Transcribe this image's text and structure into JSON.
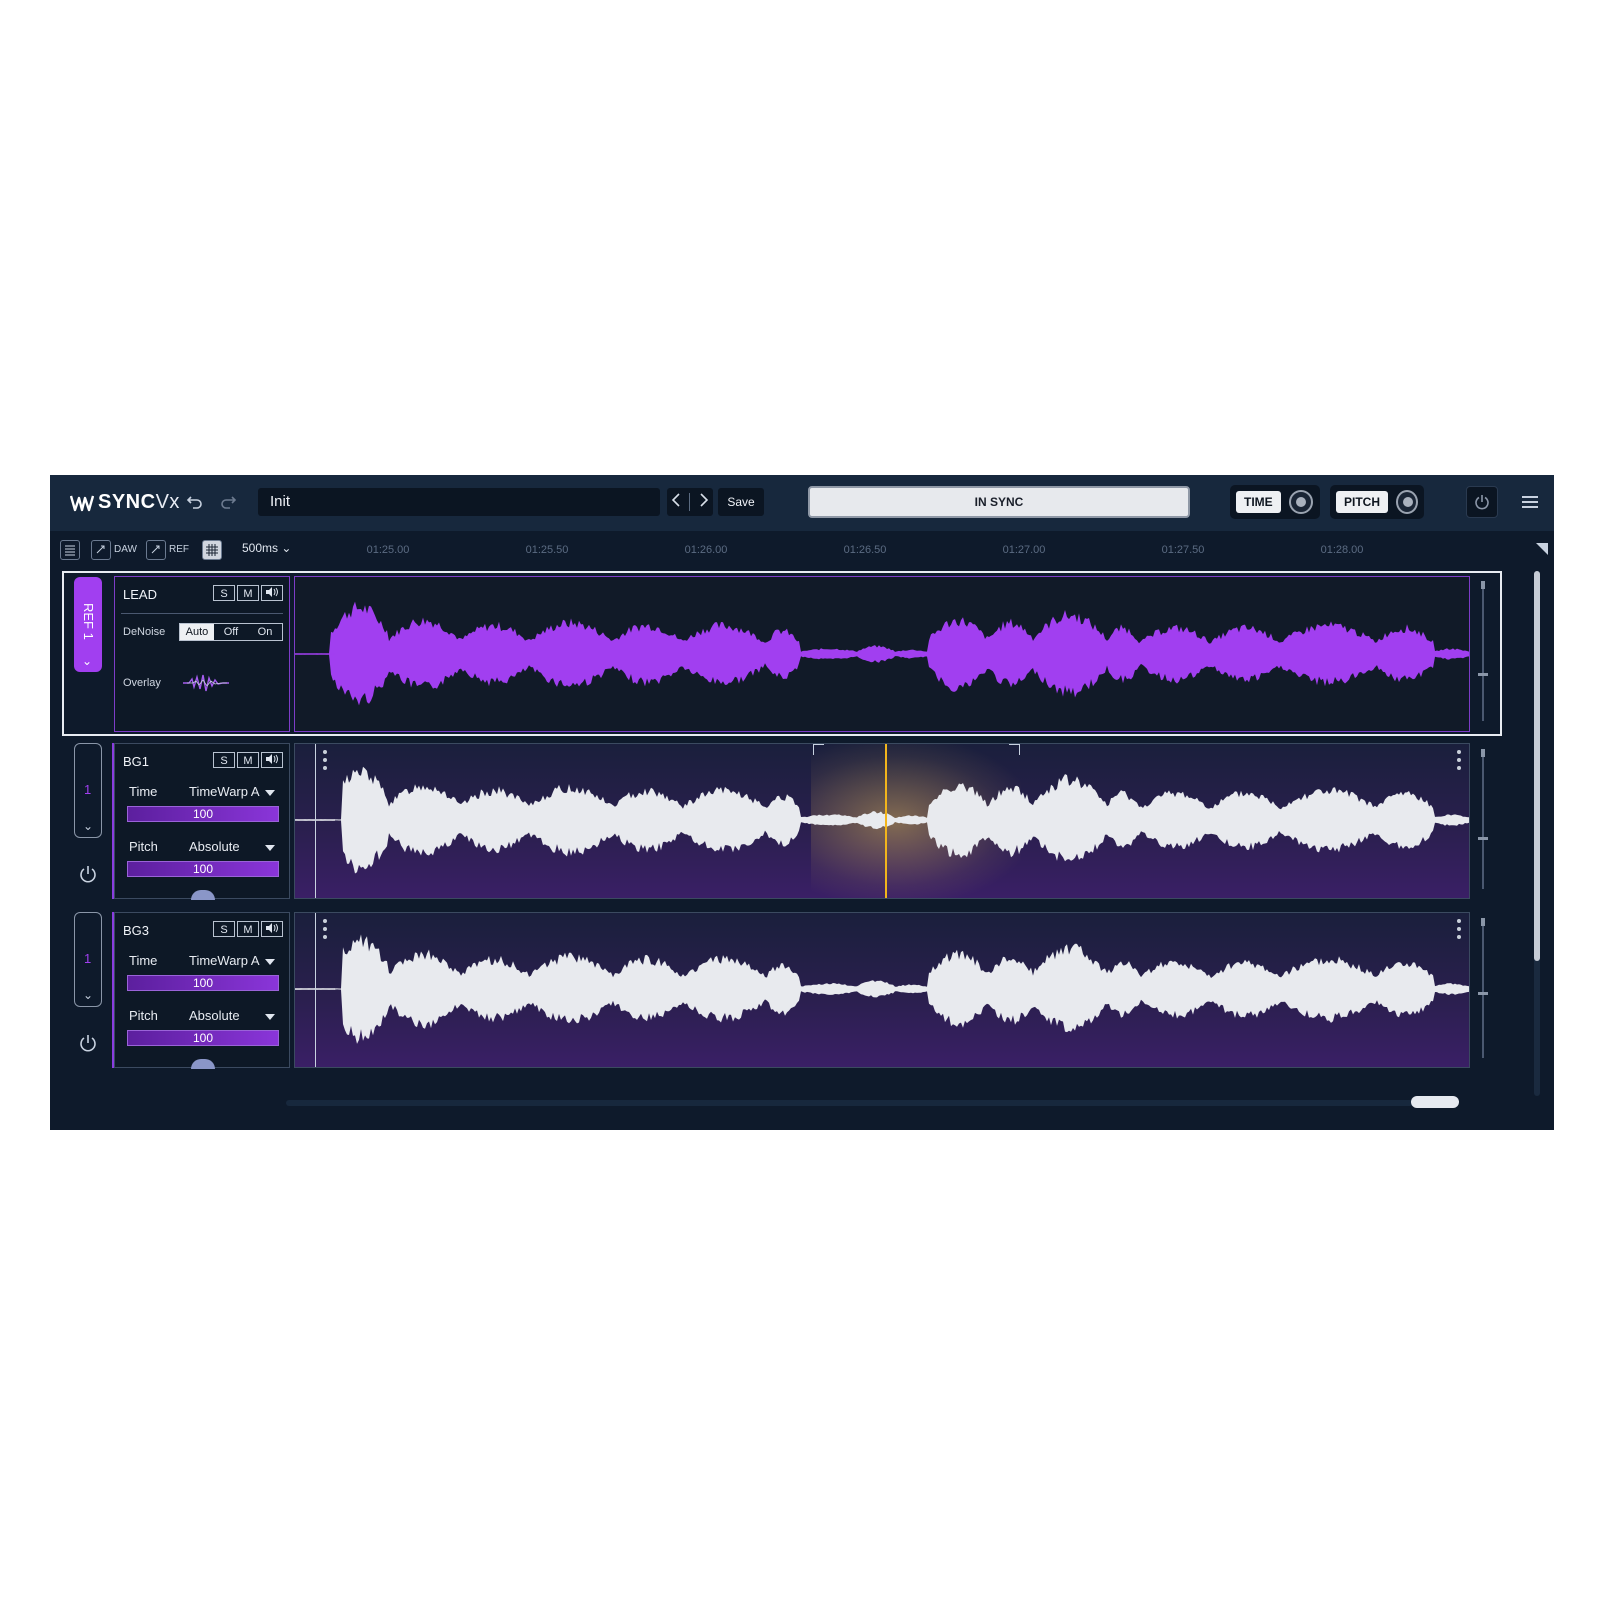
{
  "app": {
    "brand": "SYNC",
    "brand_suffix": "Vx"
  },
  "header": {
    "preset_name": "Init",
    "save_label": "Save",
    "status": "IN SYNC",
    "time_label": "TIME",
    "pitch_label": "PITCH"
  },
  "toolbar": {
    "daw_label": "DAW",
    "ref_label": "REF",
    "grid_resolution": "500ms",
    "timeline_ticks": [
      "01:25.00",
      "01:25.50",
      "01:26.00",
      "01:26.50",
      "01:27.00",
      "01:27.50",
      "01:28.00"
    ]
  },
  "tracks": [
    {
      "tab_label": "REF 1",
      "name": "LEAD",
      "solo_label": "S",
      "mute_label": "M",
      "denoise_label": "DeNoise",
      "denoise_options": [
        "Auto",
        "Off",
        "On"
      ],
      "denoise_selected": "Auto",
      "overlay_label": "Overlay",
      "wave_color": "#a13ff0"
    },
    {
      "tab_label": "1",
      "name": "BG1",
      "solo_label": "S",
      "mute_label": "M",
      "time_label": "Time",
      "time_mode": "TimeWarp A",
      "time_amount": "100",
      "pitch_label": "Pitch",
      "pitch_mode": "Absolute",
      "pitch_amount": "100",
      "wave_color": "#e8eaee"
    },
    {
      "tab_label": "1",
      "name": "BG3",
      "solo_label": "S",
      "mute_label": "M",
      "time_label": "Time",
      "time_mode": "TimeWarp A",
      "time_amount": "100",
      "pitch_label": "Pitch",
      "pitch_mode": "Absolute",
      "pitch_amount": "100",
      "wave_color": "#e8eaee"
    }
  ],
  "colors": {
    "accent": "#9b3ff0",
    "playhead": "#f2b51c",
    "panel_bg": "#0e1a2b",
    "header_bg": "#17283d"
  }
}
